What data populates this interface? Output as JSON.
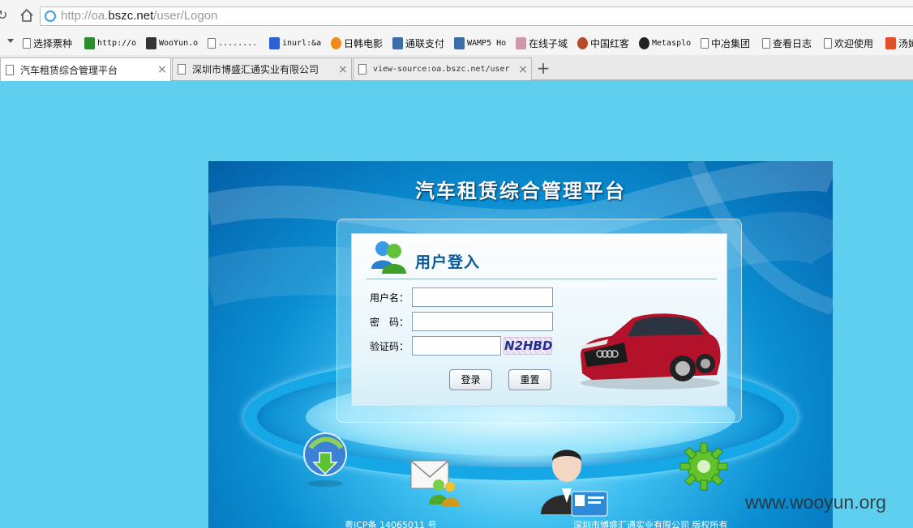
{
  "browser": {
    "url_prefix": "http://oa.",
    "url_domain": "bszc.net",
    "url_path": "/user/Logon",
    "bookmarks": [
      {
        "label": "选择票种",
        "icon": "page-icon",
        "mono": false
      },
      {
        "label": "http://o",
        "icon": "gear-icon",
        "mono": true
      },
      {
        "label": "WooYun.o",
        "icon": "wooyun-icon",
        "mono": true
      },
      {
        "label": "........",
        "icon": "page-icon",
        "mono": true
      },
      {
        "label": "inurl:&a",
        "icon": "paw-icon",
        "mono": true
      },
      {
        "label": "日韩电影",
        "icon": "play-icon",
        "mono": false
      },
      {
        "label": "通联支付",
        "icon": "tools-icon",
        "mono": false
      },
      {
        "label": "WAMP5 Ho",
        "icon": "tools-icon",
        "mono": true
      },
      {
        "label": "在线子域",
        "icon": "face-icon",
        "mono": false
      },
      {
        "label": "中国红客",
        "icon": "badge-icon",
        "mono": false
      },
      {
        "label": "Metasplo",
        "icon": "skull-icon",
        "mono": true
      },
      {
        "label": "中冶集团",
        "icon": "page-icon",
        "mono": false
      },
      {
        "label": "查看日志",
        "icon": "page-icon",
        "mono": false
      },
      {
        "label": "欢迎使用",
        "icon": "page-icon",
        "mono": false
      },
      {
        "label": "汤姆",
        "icon": "heart-icon",
        "mono": false
      }
    ],
    "tabs": [
      {
        "title": "汽车租赁综合管理平台",
        "active": true,
        "mono": false
      },
      {
        "title": "深圳市博盛汇通实业有限公司",
        "active": false,
        "mono": false
      },
      {
        "title": "view-source:oa.bszc.net/user",
        "active": false,
        "mono": true
      }
    ],
    "close_glyph": "×",
    "new_tab_glyph": "+"
  },
  "page": {
    "title": "汽车租赁综合管理平台",
    "login": {
      "heading": "用户登入",
      "username_label": "用户名：",
      "password_label": "密　码：",
      "captcha_label": "验证码：",
      "username_value": "",
      "password_value": "",
      "captcha_value": "",
      "captcha_image_text": "N2HBD",
      "login_button": "登录",
      "reset_button": "重置"
    },
    "footer": {
      "icp": "粤ICP备 14065011 号",
      "copyright": "深圳市博盛汇通实业有限公司 版权所有"
    },
    "watermark": "www.wooyun.org"
  }
}
